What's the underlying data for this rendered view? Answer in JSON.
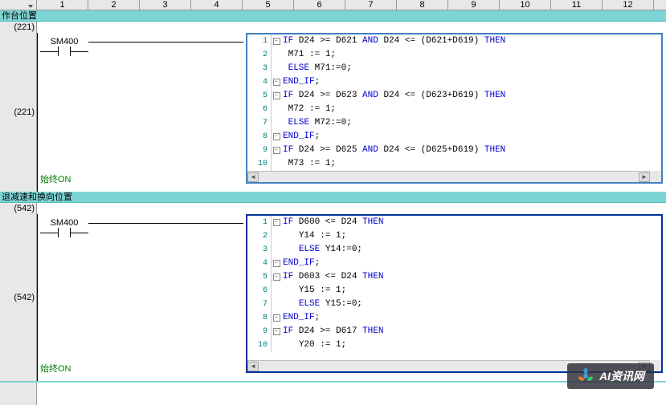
{
  "columns": [
    "1",
    "2",
    "3",
    "4",
    "5",
    "6",
    "7",
    "8",
    "9",
    "10",
    "11",
    "12"
  ],
  "section1": {
    "title": "作台位置",
    "addr1": "(221)",
    "addr2": "(221)",
    "contact": "SM400",
    "always_on": "始终ON",
    "code": [
      {
        "n": "1",
        "fold": "-",
        "pre": "",
        "tokens": [
          [
            "kw",
            "IF"
          ],
          [
            "plain",
            " D24 >= D621 "
          ],
          [
            "kw",
            "AND"
          ],
          [
            "plain",
            " D24 <= (D621+D619) "
          ],
          [
            "kw",
            "THEN"
          ]
        ]
      },
      {
        "n": "2",
        "fold": "",
        "pre": " ",
        "tokens": [
          [
            "plain",
            "M71 := 1;"
          ]
        ]
      },
      {
        "n": "3",
        "fold": "",
        "pre": " ",
        "tokens": [
          [
            "kw",
            "ELSE"
          ],
          [
            "plain",
            " M71:=0;"
          ]
        ]
      },
      {
        "n": "4",
        "fold": "-",
        "pre": "",
        "tokens": [
          [
            "kw",
            "END_IF"
          ],
          [
            "plain",
            ";"
          ]
        ]
      },
      {
        "n": "5",
        "fold": "-",
        "pre": "",
        "tokens": [
          [
            "kw",
            "IF"
          ],
          [
            "plain",
            " D24 >= D623 "
          ],
          [
            "kw",
            "AND"
          ],
          [
            "plain",
            " D24 <= (D623+D619) "
          ],
          [
            "kw",
            "THEN"
          ]
        ]
      },
      {
        "n": "6",
        "fold": "",
        "pre": " ",
        "tokens": [
          [
            "plain",
            "M72 := 1;"
          ]
        ]
      },
      {
        "n": "7",
        "fold": "",
        "pre": " ",
        "tokens": [
          [
            "kw",
            "ELSE"
          ],
          [
            "plain",
            " M72:=0;"
          ]
        ]
      },
      {
        "n": "8",
        "fold": "-",
        "pre": "",
        "tokens": [
          [
            "kw",
            "END_IF"
          ],
          [
            "plain",
            ";"
          ]
        ]
      },
      {
        "n": "9",
        "fold": "-",
        "pre": "",
        "tokens": [
          [
            "kw",
            "IF"
          ],
          [
            "plain",
            " D24 >= D625 "
          ],
          [
            "kw",
            "AND"
          ],
          [
            "plain",
            " D24 <= (D625+D619) "
          ],
          [
            "kw",
            "THEN"
          ]
        ]
      },
      {
        "n": "10",
        "fold": "",
        "pre": " ",
        "tokens": [
          [
            "plain",
            "M73 := 1;"
          ]
        ]
      }
    ]
  },
  "section2": {
    "title": "退减速和换向位置",
    "addr1": "(542)",
    "addr2": "(542)",
    "contact": "SM400",
    "always_on": "始终ON",
    "code": [
      {
        "n": "1",
        "fold": "-",
        "pre": "",
        "tokens": [
          [
            "kw",
            "IF"
          ],
          [
            "plain",
            " D600 <= D24 "
          ],
          [
            "kw",
            "THEN"
          ]
        ]
      },
      {
        "n": "2",
        "fold": "",
        "pre": "   ",
        "tokens": [
          [
            "plain",
            "Y14 := 1;"
          ]
        ]
      },
      {
        "n": "3",
        "fold": "",
        "pre": "   ",
        "tokens": [
          [
            "kw",
            "ELSE"
          ],
          [
            "plain",
            " Y14:=0;"
          ]
        ]
      },
      {
        "n": "4",
        "fold": "-",
        "pre": "",
        "tokens": [
          [
            "kw",
            "END_IF"
          ],
          [
            "plain",
            ";"
          ]
        ]
      },
      {
        "n": "5",
        "fold": "-",
        "pre": "",
        "tokens": [
          [
            "kw",
            "IF"
          ],
          [
            "plain",
            " D603 <= D24 "
          ],
          [
            "kw",
            "THEN"
          ]
        ]
      },
      {
        "n": "6",
        "fold": "",
        "pre": "   ",
        "tokens": [
          [
            "plain",
            "Y15 := 1;"
          ]
        ]
      },
      {
        "n": "7",
        "fold": "",
        "pre": "   ",
        "tokens": [
          [
            "kw",
            "ELSE"
          ],
          [
            "plain",
            " Y15:=0;"
          ]
        ]
      },
      {
        "n": "8",
        "fold": "-",
        "pre": "",
        "tokens": [
          [
            "kw",
            "END_IF"
          ],
          [
            "plain",
            ";"
          ]
        ]
      },
      {
        "n": "9",
        "fold": "-",
        "pre": "",
        "tokens": [
          [
            "kw",
            "IF"
          ],
          [
            "plain",
            " D24 >= D617 "
          ],
          [
            "kw",
            "THEN"
          ]
        ]
      },
      {
        "n": "10",
        "fold": "",
        "pre": "   ",
        "tokens": [
          [
            "plain",
            "Y20 := 1;"
          ]
        ]
      }
    ]
  },
  "watermark": "AI资讯网"
}
